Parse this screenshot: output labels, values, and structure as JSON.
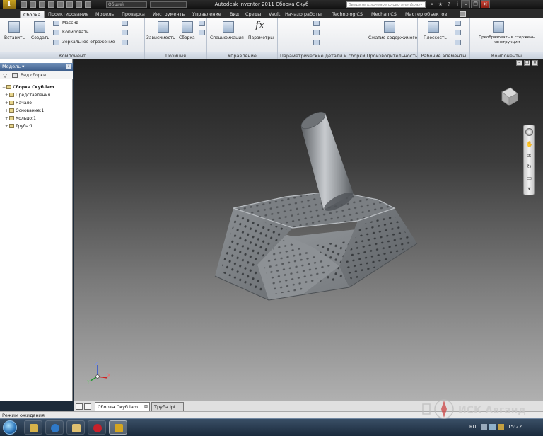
{
  "window": {
    "title": "Autodesk Inventor 2011     Сборка Скуб",
    "app_logo": "I",
    "qa_combo_1": "Общий",
    "qa_combo_2": "",
    "search_placeholder": "Введите ключевое слово или фразу",
    "minimize": "–",
    "restore": "❐",
    "close": "✕"
  },
  "ribbon_tabs": [
    {
      "label": "Сборка",
      "active": true
    },
    {
      "label": "Проектирование"
    },
    {
      "label": "Модель"
    },
    {
      "label": "Проверка"
    },
    {
      "label": "Инструменты"
    },
    {
      "label": "Управление"
    },
    {
      "label": "Вид"
    },
    {
      "label": "Среды"
    },
    {
      "label": "Vault"
    },
    {
      "label": "Начало работы"
    },
    {
      "label": "TechnologiCS"
    },
    {
      "label": "MechaniCS"
    },
    {
      "label": "Мастер объектов"
    }
  ],
  "ribbon": {
    "component": {
      "insert": "Вставить",
      "create": "Создать",
      "pattern": "Массив",
      "copy": "Копировать",
      "mirror": "Зеркальное отражение",
      "label": "Компонент"
    },
    "position": {
      "constrain": "Зависимость",
      "assemble": "Сборка",
      "label": "Позиция"
    },
    "manage": {
      "spec": "Спецификация",
      "params": "Параметры",
      "label": "Управление"
    },
    "productivity": {
      "label_1": "Параметрические детали и сборки",
      "label_2": "Производительность",
      "shrink": "Сжатие содержимого"
    },
    "work_features": {
      "button": "Плоскость",
      "label": "Рабочие элементы"
    },
    "design": {
      "button": "Преобразовать в стержень конструкции",
      "label": "Компоненты"
    }
  },
  "browser": {
    "header": "Модель",
    "header_button": "?",
    "toolbar_label": "Вид сборки",
    "tree": [
      {
        "label": "Сборка Скуб.iam",
        "level": 0,
        "expander": "−"
      },
      {
        "label": "Представления",
        "level": 1,
        "expander": "+"
      },
      {
        "label": "Начало",
        "level": 1,
        "expander": "+"
      },
      {
        "label": "Основание:1",
        "level": 1,
        "expander": "+"
      },
      {
        "label": "Кольцо:1",
        "level": 1,
        "expander": "+"
      },
      {
        "label": "Труба:1",
        "level": 1,
        "expander": "+"
      }
    ]
  },
  "viewport": {
    "ctrl_minimize": "–",
    "ctrl_restore": "❐",
    "ctrl_close": "✕"
  },
  "doc_tabs": [
    {
      "label": "Сборка Скуб.iam",
      "active": true
    },
    {
      "label": "Труба.ipt",
      "active": false
    }
  ],
  "status": {
    "text": "Режим ожидания"
  },
  "taskbar": {
    "lang": "RU",
    "clock": "15:22"
  },
  "watermark": {
    "text": "ИСК Авганд"
  },
  "colors": {
    "ribbon_accent": "#3f5f8c",
    "model_metal": "#8e9296",
    "viewport_top": "#1f1f1f",
    "viewport_bottom": "#b0b0b0"
  }
}
